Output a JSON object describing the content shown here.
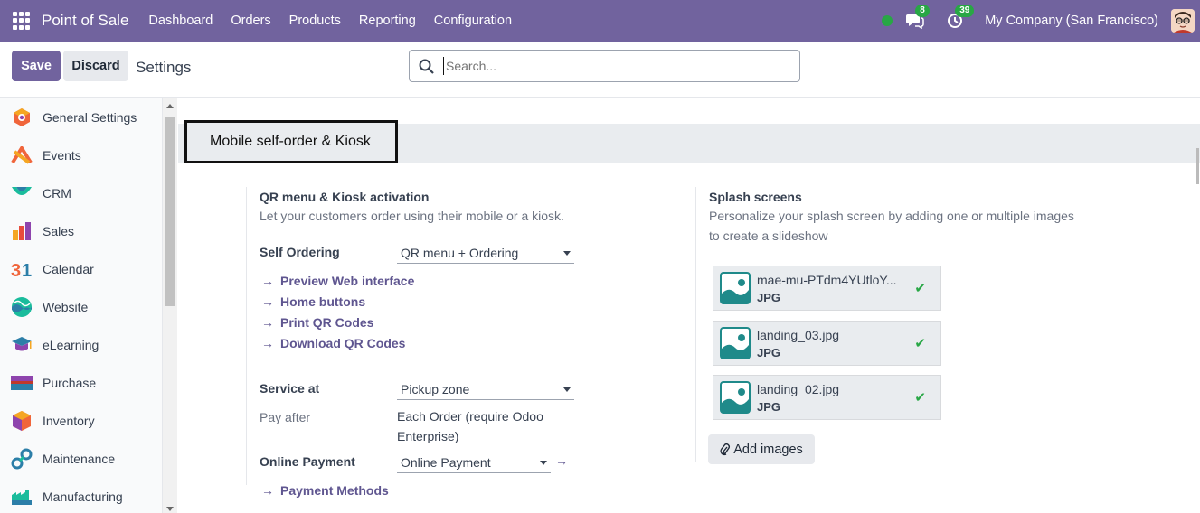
{
  "navbar": {
    "brand": "Point of Sale",
    "menu": [
      "Dashboard",
      "Orders",
      "Products",
      "Reporting",
      "Configuration"
    ],
    "messages_count": "8",
    "activities_count": "39",
    "company": "My Company (San Francisco)"
  },
  "control": {
    "save_label": "Save",
    "discard_label": "Discard",
    "title": "Settings",
    "search_placeholder": "Search..."
  },
  "sidebar": {
    "items": [
      {
        "label": "General Settings",
        "icon": "general-settings-icon"
      },
      {
        "label": "Events",
        "icon": "events-icon"
      },
      {
        "label": "CRM",
        "icon": "crm-icon"
      },
      {
        "label": "Sales",
        "icon": "sales-icon"
      },
      {
        "label": "Calendar",
        "icon": "calendar-icon"
      },
      {
        "label": "Website",
        "icon": "website-icon"
      },
      {
        "label": "eLearning",
        "icon": "elearning-icon"
      },
      {
        "label": "Purchase",
        "icon": "purchase-icon"
      },
      {
        "label": "Inventory",
        "icon": "inventory-icon"
      },
      {
        "label": "Maintenance",
        "icon": "maintenance-icon"
      },
      {
        "label": "Manufacturing",
        "icon": "manufacturing-icon"
      }
    ]
  },
  "section": {
    "title": "Mobile self-order & Kiosk"
  },
  "qr": {
    "title": "QR menu & Kiosk activation",
    "desc": "Let your customers order using their mobile or a kiosk.",
    "self_ordering_label": "Self Ordering",
    "self_ordering_value": "QR menu + Ordering",
    "links": [
      "Preview Web interface",
      "Home buttons",
      "Print QR Codes",
      "Download QR Codes"
    ],
    "service_label": "Service at",
    "service_value": "Pickup zone",
    "pay_after_label": "Pay after",
    "pay_after_value_1": "Each Order (require Odoo",
    "pay_after_value_2": "Enterprise)",
    "online_payment_label": "Online Payment",
    "online_payment_value": "Online Payment",
    "payment_methods_link": "Payment Methods"
  },
  "splash": {
    "title": "Splash screens",
    "desc_1": "Personalize your splash screen by adding one or multiple images",
    "desc_2": "to create a slideshow",
    "images": [
      {
        "name": "mae-mu-PTdm4YUtloY...",
        "type": "JPG"
      },
      {
        "name": "landing_03.jpg",
        "type": "JPG"
      },
      {
        "name": "landing_02.jpg",
        "type": "JPG"
      }
    ],
    "add_label": "Add images"
  },
  "colors": {
    "brand": "#71639e",
    "link": "#5f5690",
    "success": "#28a745"
  }
}
